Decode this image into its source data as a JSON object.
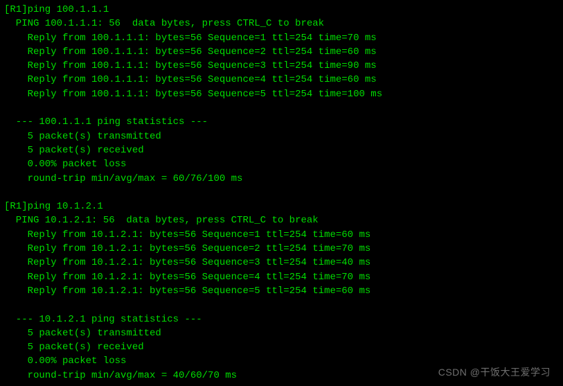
{
  "ping1": {
    "prompt": "[R1]ping 100.1.1.1",
    "header": "  PING 100.1.1.1: 56  data bytes, press CTRL_C to break",
    "replies": [
      "    Reply from 100.1.1.1: bytes=56 Sequence=1 ttl=254 time=70 ms",
      "    Reply from 100.1.1.1: bytes=56 Sequence=2 ttl=254 time=60 ms",
      "    Reply from 100.1.1.1: bytes=56 Sequence=3 ttl=254 time=90 ms",
      "    Reply from 100.1.1.1: bytes=56 Sequence=4 ttl=254 time=60 ms",
      "    Reply from 100.1.1.1: bytes=56 Sequence=5 ttl=254 time=100 ms"
    ],
    "stats_header": "  --- 100.1.1.1 ping statistics ---",
    "stats": [
      "    5 packet(s) transmitted",
      "    5 packet(s) received",
      "    0.00% packet loss",
      "    round-trip min/avg/max = 60/76/100 ms"
    ]
  },
  "ping2": {
    "prompt": "[R1]ping 10.1.2.1",
    "header": "  PING 10.1.2.1: 56  data bytes, press CTRL_C to break",
    "replies": [
      "    Reply from 10.1.2.1: bytes=56 Sequence=1 ttl=254 time=60 ms",
      "    Reply from 10.1.2.1: bytes=56 Sequence=2 ttl=254 time=70 ms",
      "    Reply from 10.1.2.1: bytes=56 Sequence=3 ttl=254 time=40 ms",
      "    Reply from 10.1.2.1: bytes=56 Sequence=4 ttl=254 time=70 ms",
      "    Reply from 10.1.2.1: bytes=56 Sequence=5 ttl=254 time=60 ms"
    ],
    "stats_header": "  --- 10.1.2.1 ping statistics ---",
    "stats": [
      "    5 packet(s) transmitted",
      "    5 packet(s) received",
      "    0.00% packet loss",
      "    round-trip min/avg/max = 40/60/70 ms"
    ]
  },
  "watermark": "CSDN @干饭大王爱学习"
}
